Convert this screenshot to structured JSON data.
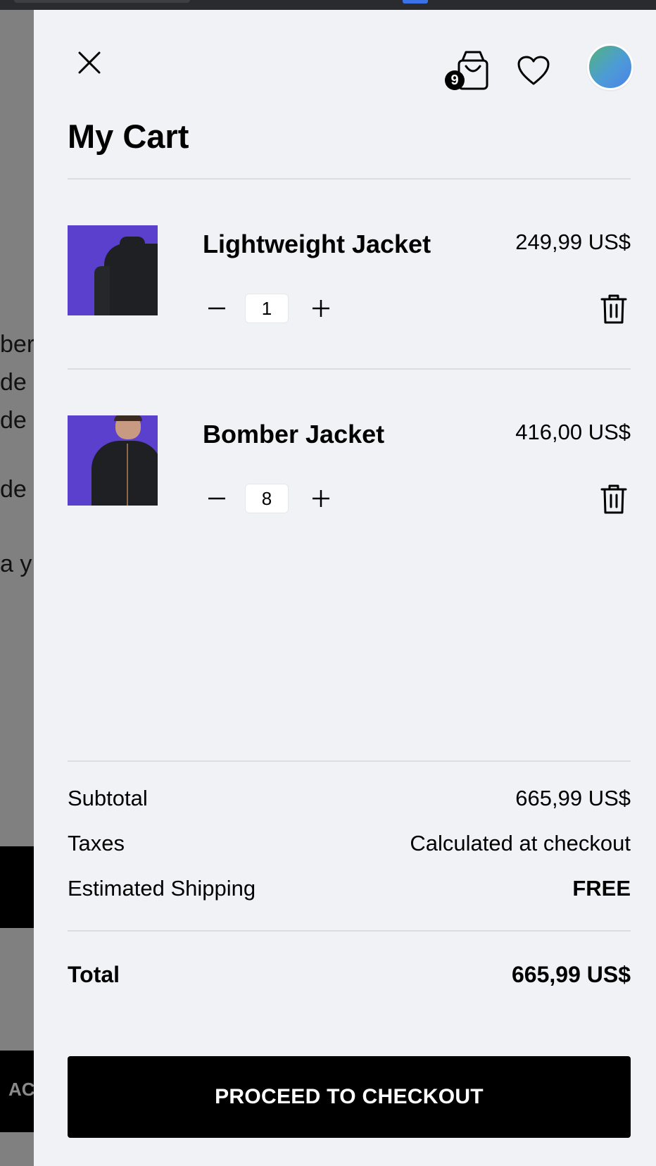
{
  "background_page": {
    "text_fragments": [
      "ber",
      "de a",
      "de a",
      "de",
      "a y"
    ],
    "button_fragment": "AC"
  },
  "header": {
    "cart_badge_count": "9",
    "title": "My Cart"
  },
  "cart": {
    "items": [
      {
        "name": "Lightweight Jacket",
        "price": "249,99 US$",
        "quantity": "1"
      },
      {
        "name": "Bomber Jacket",
        "price": "416,00 US$",
        "quantity": "8"
      }
    ]
  },
  "summary": {
    "subtotal_label": "Subtotal",
    "subtotal_value": "665,99 US$",
    "taxes_label": "Taxes",
    "taxes_value": "Calculated at checkout",
    "shipping_label": "Estimated Shipping",
    "shipping_value": "FREE",
    "total_label": "Total",
    "total_value": "665,99 US$"
  },
  "checkout_button_label": "PROCEED TO CHECKOUT",
  "colors": {
    "product_background": "#5b3fcd",
    "drawer_background": "#f1f2f5",
    "button": "#000000"
  }
}
